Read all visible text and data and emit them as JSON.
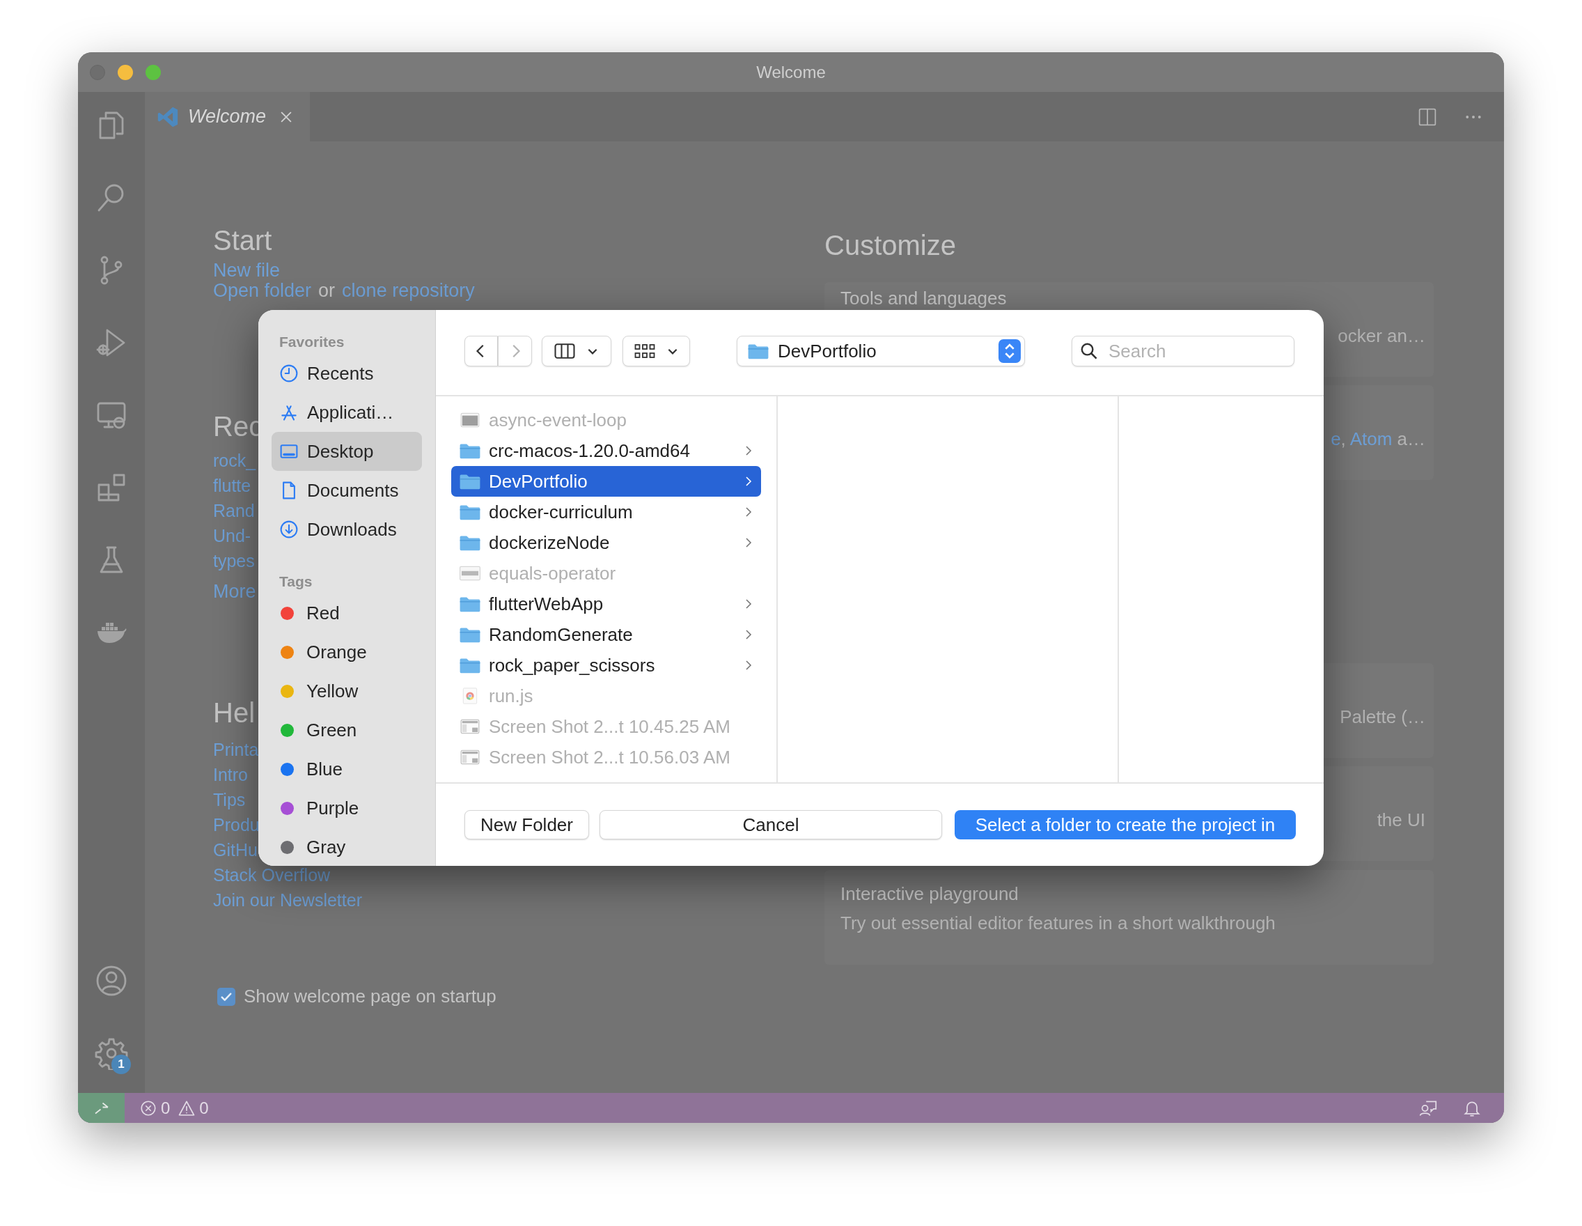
{
  "window": {
    "title": "Welcome"
  },
  "activity_bar": {
    "settings_badge": "1"
  },
  "tabs": [
    {
      "label": "Welcome",
      "selected": true
    }
  ],
  "start": {
    "heading": "Start",
    "new_file": "New file",
    "open_line": [
      {
        "text": "Open folder",
        "link": true
      },
      {
        "text": "or",
        "link": false
      },
      {
        "text": "clone repository",
        "link": true
      }
    ]
  },
  "recent": {
    "heading": "Rec",
    "items": [
      "rock_",
      "flutte",
      "Rand",
      "Und-",
      "types"
    ],
    "more": "More"
  },
  "help": {
    "heading": "Hel",
    "items": [
      "Printa",
      "Intro",
      "Tips",
      "Produ",
      "GitHu",
      "Stack Overflow",
      "Join our Newsletter"
    ]
  },
  "show_on_startup": {
    "label": "Show welcome page on startup",
    "checked": true
  },
  "customize": {
    "heading": "Customize",
    "cards": [
      {
        "kind": "partial",
        "title": "Tools and languages",
        "description": [
          {
            "text": "ocker an…",
            "link": false
          }
        ]
      },
      {
        "kind": "partial",
        "description": [
          {
            "text": "e",
            "link": true
          },
          {
            "text": ", ",
            "link": false
          },
          {
            "text": "Atom",
            "link": true
          },
          {
            "text": " a…",
            "link": false
          }
        ]
      },
      {
        "kind": "partial",
        "description": [
          {
            "text": "Palette (…",
            "link": false
          }
        ]
      },
      {
        "kind": "partial",
        "description": [
          {
            "text": "the UI",
            "link": false
          }
        ]
      },
      {
        "kind": "full",
        "title": "Interactive playground",
        "description": [
          {
            "text": "Try out essential editor features in a short walkthrough",
            "link": false
          }
        ]
      }
    ]
  },
  "file_dialog": {
    "sidebar": {
      "favorites_heading": "Favorites",
      "favorites": [
        {
          "kind": "recents",
          "label": "Recents",
          "selected": false
        },
        {
          "kind": "applications",
          "label": "Applicati…",
          "selected": false
        },
        {
          "kind": "desktop",
          "label": "Desktop",
          "selected": true
        },
        {
          "kind": "documents",
          "label": "Documents",
          "selected": false
        },
        {
          "kind": "downloads",
          "label": "Downloads",
          "selected": false
        }
      ],
      "tags_heading": "Tags",
      "tags": [
        {
          "label": "Red",
          "color": "#f2423a"
        },
        {
          "label": "Orange",
          "color": "#ee8312"
        },
        {
          "label": "Yellow",
          "color": "#eab611"
        },
        {
          "label": "Green",
          "color": "#21b83a"
        },
        {
          "label": "Blue",
          "color": "#1a73f0"
        },
        {
          "label": "Purple",
          "color": "#a64fd5"
        },
        {
          "label": "Gray",
          "color": "#6d6d71"
        }
      ]
    },
    "path": "DevPortfolio",
    "search": {
      "placeholder": "Search"
    },
    "items": [
      {
        "kind": "exec",
        "name": "async-event-loop",
        "disabled": true,
        "selected": false
      },
      {
        "kind": "folder",
        "name": "crc-macos-1.20.0-amd64",
        "disabled": false,
        "selected": false
      },
      {
        "kind": "folder",
        "name": "DevPortfolio",
        "disabled": false,
        "selected": true
      },
      {
        "kind": "folder",
        "name": "docker-curriculum",
        "disabled": false,
        "selected": false
      },
      {
        "kind": "folder",
        "name": "dockerizeNode",
        "disabled": false,
        "selected": false
      },
      {
        "kind": "document",
        "name": "equals-operator",
        "disabled": true,
        "selected": false
      },
      {
        "kind": "folder",
        "name": "flutterWebApp",
        "disabled": false,
        "selected": false
      },
      {
        "kind": "folder",
        "name": "RandomGenerate",
        "disabled": false,
        "selected": false
      },
      {
        "kind": "folder",
        "name": "rock_paper_scissors",
        "disabled": false,
        "selected": false
      },
      {
        "kind": "script",
        "name": "run.js",
        "disabled": true,
        "selected": false
      },
      {
        "kind": "image",
        "name": "Screen Shot 2...t 10.45.25 AM",
        "disabled": true,
        "selected": false
      },
      {
        "kind": "image",
        "name": "Screen Shot 2...t 10.56.03 AM",
        "disabled": true,
        "selected": false
      }
    ],
    "buttons": {
      "new_folder": "New Folder",
      "cancel": "Cancel",
      "confirm": "Select a folder to create the project in"
    }
  },
  "status_bar": {
    "errors": "0",
    "warnings": "0"
  }
}
